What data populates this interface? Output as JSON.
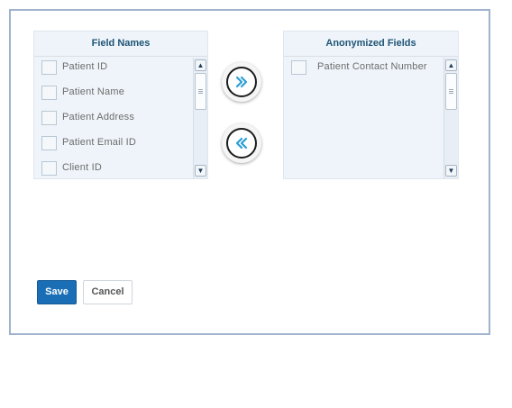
{
  "field_names": {
    "header": "Field Names",
    "items": [
      {
        "label": "Patient ID",
        "checked": false
      },
      {
        "label": "Patient Name",
        "checked": false
      },
      {
        "label": "Patient Address",
        "checked": false
      },
      {
        "label": "Patient Email ID",
        "checked": false
      },
      {
        "label": "Client ID",
        "checked": false
      }
    ]
  },
  "anonymized_fields": {
    "header": "Anonymized Fields",
    "items": [
      {
        "label": "Patient Contact Number",
        "checked": false
      }
    ]
  },
  "scroll": {
    "up_glyph": "▲",
    "down_glyph": "▼"
  },
  "actions": {
    "save_label": "Save",
    "cancel_label": "Cancel"
  },
  "colors": {
    "accent": "#1a6eb6",
    "header_text": "#1f5476",
    "arrow": "#2a9fd6",
    "frame_border": "#9fb3cf"
  },
  "icons": {
    "move_right": "double-chevron-right-icon",
    "move_left": "double-chevron-left-icon"
  }
}
